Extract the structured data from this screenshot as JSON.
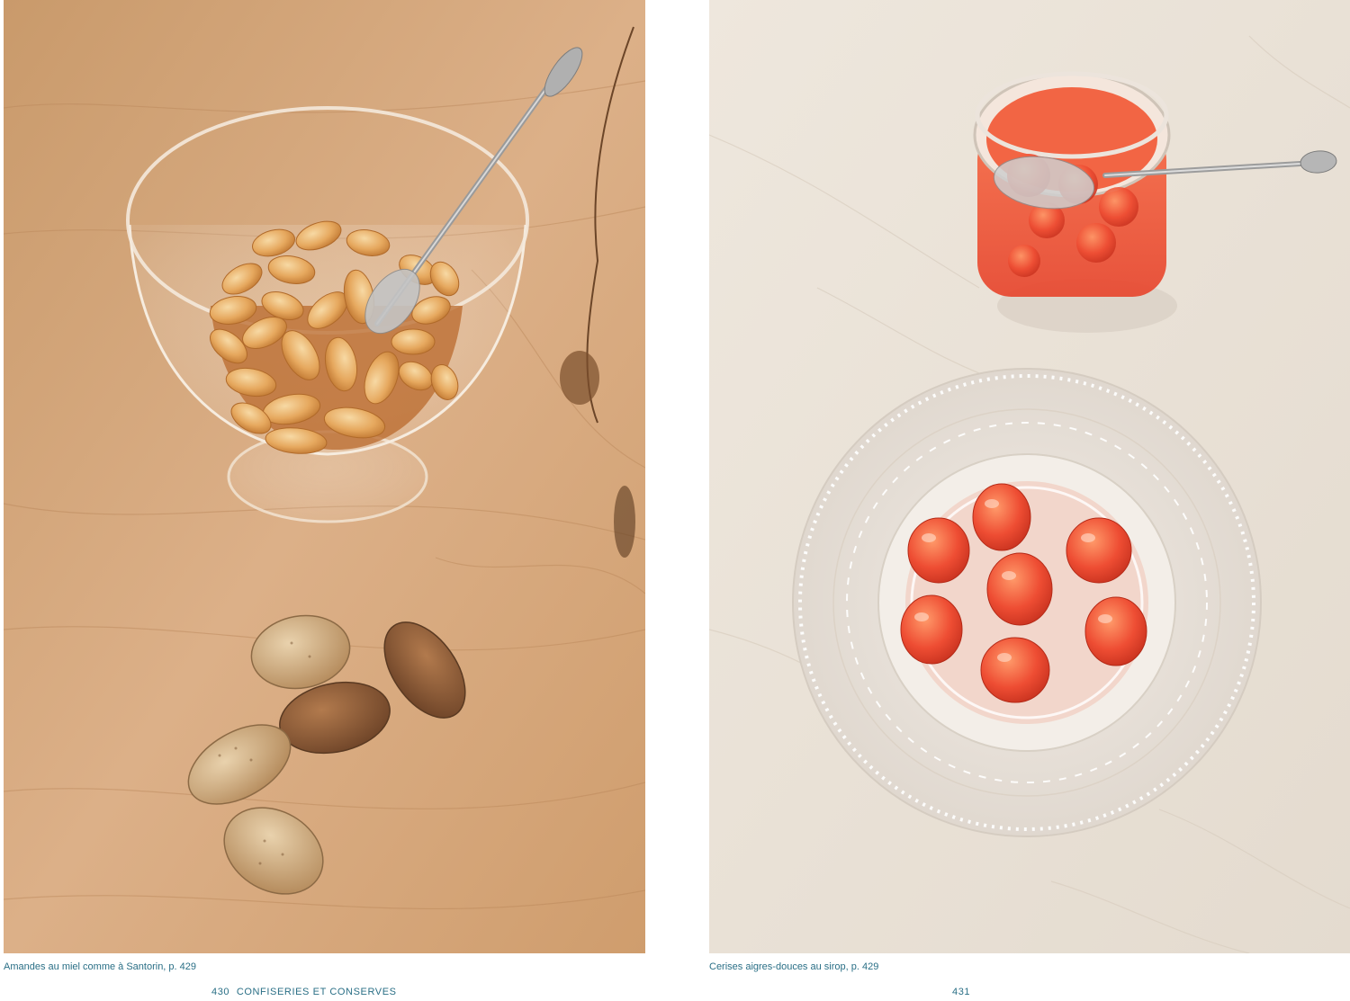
{
  "left_page": {
    "caption": "Amandes au miel comme à Santorin, p. 429",
    "page_number": "430",
    "running_head": "CONFISERIES ET CONSERVES",
    "photo_subject": "almonds-in-honey-glass-bowl"
  },
  "right_page": {
    "caption": "Cerises aigres-douces au sirop, p. 429",
    "page_number": "431",
    "photo_subject": "cherries-in-syrup-jar-and-plate"
  },
  "colors": {
    "caption_text": "#2a6f86",
    "wood_background": "#d4a678",
    "marble_background": "#ece4da",
    "almond": "#e2a35a",
    "cherry": "#e8503a"
  }
}
